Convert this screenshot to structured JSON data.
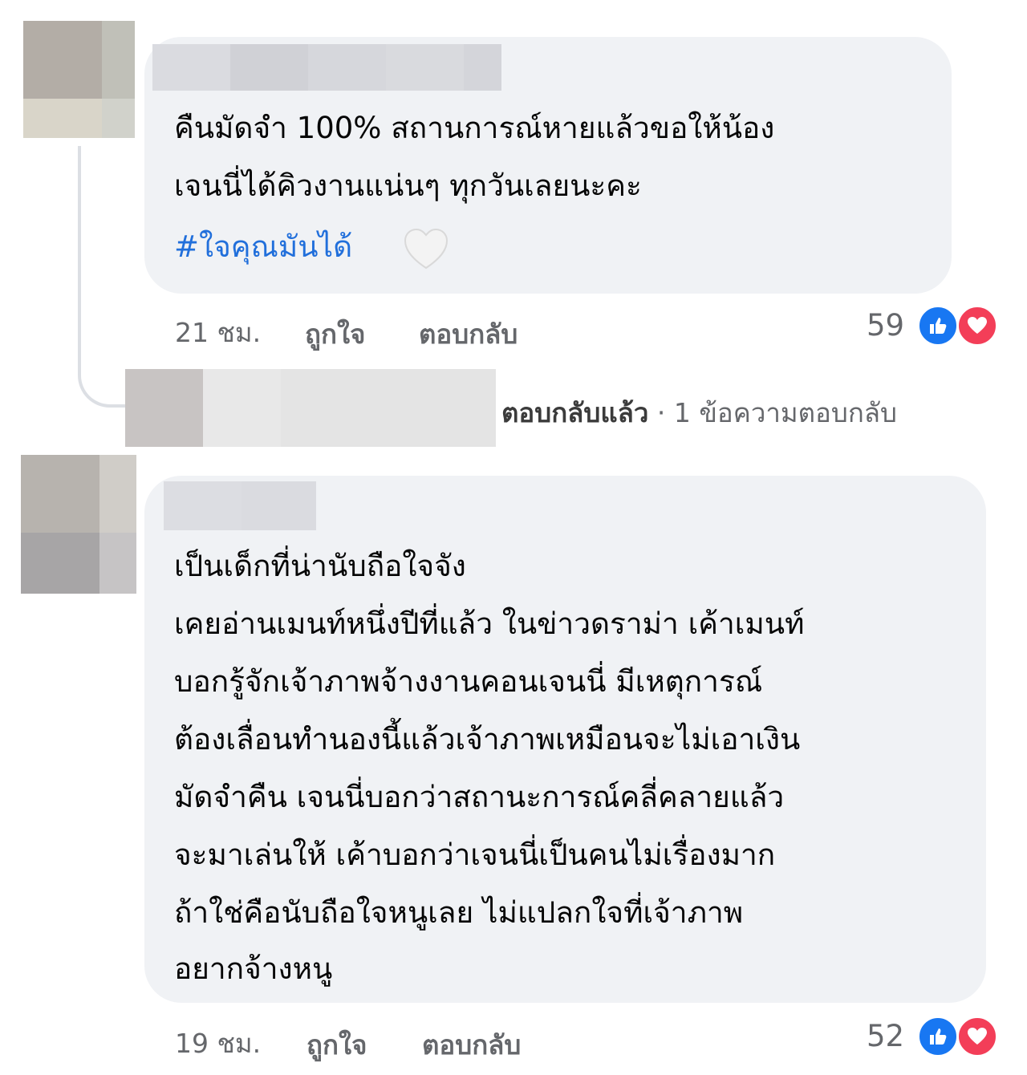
{
  "comments": [
    {
      "lines": [
        "คืนมัดจำ 100% สถานการณ์หายแล้วขอให้น้อง",
        "เจนนี่ได้คิวงานแน่นๆ ทุกวันเลยนะคะ"
      ],
      "hashtag": "#ใจคุณมันได้",
      "emoji_icon": "white-heart-icon",
      "time": "21 ชม.",
      "like_label": "ถูกใจ",
      "reply_label": "ตอบกลับ",
      "reaction_count": "59",
      "reactions": [
        "like-icon",
        "love-icon"
      ],
      "replies_summary": {
        "replied": "ตอบกลับแล้ว",
        "separator": "·",
        "count_text": "1 ข้อความตอบกลับ"
      }
    },
    {
      "lines": [
        "เป็นเด็กที่น่านับถือใจจัง",
        "เคยอ่านเมนท์หนึ่งปีที่แล้ว ในข่าวดราม่า เค้าเมนท์",
        "บอกรู้จักเจ้าภาพจ้างงานคอนเจนนี่ มีเหตุการณ์",
        "ต้องเลื่อนทำนองนี้แล้วเจ้าภาพเหมือนจะไม่เอาเงิน",
        "มัดจำคืน เจนนี่บอกว่าสถานะการณ์คลี่คลายแล้ว",
        "จะมาเล่นให้ เค้าบอกว่าเจนนี่เป็นคนไม่เรื่องมาก",
        "ถ้าใช่คือนับถือใจหนูเลย ไม่แปลกใจที่เจ้าภาพ",
        "อยากจ้างหนู"
      ],
      "time": "19 ชม.",
      "like_label": "ถูกใจ",
      "reply_label": "ตอบกลับ",
      "reaction_count": "52",
      "reactions": [
        "like-icon",
        "love-icon"
      ]
    }
  ],
  "colors": {
    "bubble": "#f0f2f5",
    "hashtag": "#216fdb",
    "meta": "#65676b",
    "like": "#1877f2",
    "love": "#f33e58"
  }
}
